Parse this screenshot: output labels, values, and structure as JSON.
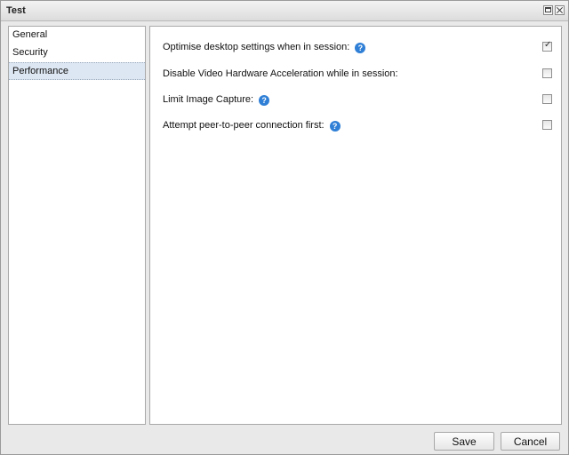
{
  "window": {
    "title": "Test",
    "controls": [
      "maximize-icon",
      "close-icon"
    ]
  },
  "sidebar": {
    "items": [
      {
        "label": "General"
      },
      {
        "label": "Security"
      },
      {
        "label": "Performance",
        "selected": true
      }
    ]
  },
  "settings": [
    {
      "label": "Optimise desktop settings when in session:",
      "help_icon": true,
      "checked": true
    },
    {
      "label": "Disable Video Hardware Acceleration while in session:",
      "help_icon": false,
      "checked": false
    },
    {
      "label": "Limit Image Capture:",
      "help_icon": true,
      "checked": false
    },
    {
      "label": "Attempt peer-to-peer connection first:",
      "help_icon": true,
      "checked": false
    }
  ],
  "help_glyph": "?",
  "buttons": {
    "save_label": "Save",
    "cancel_label": "Cancel"
  },
  "colors": {
    "selection": "#dde7f3",
    "help_icon": "#2f7fd6"
  }
}
